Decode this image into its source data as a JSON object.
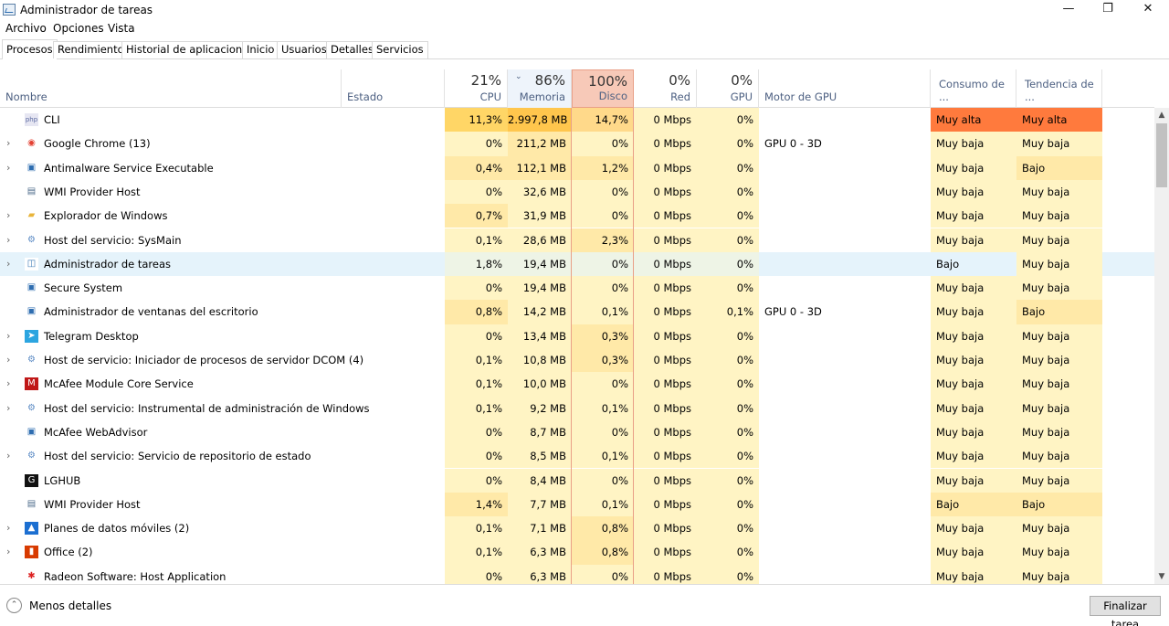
{
  "window": {
    "title": "Administrador de tareas",
    "minimize": "—",
    "maximize": "❐",
    "close": "✕"
  },
  "menu": [
    "Archivo",
    "Opciones",
    "Vista"
  ],
  "tabs": [
    "Procesos",
    "Rendimiento",
    "Historial de aplicaciones",
    "Inicio",
    "Usuarios",
    "Detalles",
    "Servicios"
  ],
  "header": {
    "name": "Nombre",
    "status": "Estado",
    "cpu_pct": "21%",
    "cpu": "CPU",
    "mem_pct": "86%",
    "mem": "Memoria",
    "disk_pct": "100%",
    "disk": "Disco",
    "net_pct": "0%",
    "net": "Red",
    "gpu_pct": "0%",
    "gpu": "GPU",
    "gpu_engine": "Motor de GPU",
    "power": "Consumo de ...",
    "trend": "Tendencia de ..."
  },
  "processes": [
    {
      "name": "CLI",
      "icon": "php-icon",
      "expand": false,
      "cpu": "11,3%",
      "mem": "2.997,8 MB",
      "disk": "14,7%",
      "net": "0 Mbps",
      "gpu": "0%",
      "engine": "",
      "power": "Muy alta",
      "trend": "Muy alta"
    },
    {
      "name": "Google Chrome (13)",
      "icon": "chrome-icon",
      "expand": true,
      "cpu": "0%",
      "mem": "211,2 MB",
      "disk": "0%",
      "net": "0 Mbps",
      "gpu": "0%",
      "engine": "GPU 0 - 3D",
      "power": "Muy baja",
      "trend": "Muy baja"
    },
    {
      "name": "Antimalware Service Executable",
      "icon": "service-window-icon",
      "expand": true,
      "cpu": "0,4%",
      "mem": "112,1 MB",
      "disk": "1,2%",
      "net": "0 Mbps",
      "gpu": "0%",
      "engine": "",
      "power": "Muy baja",
      "trend": "Bajo"
    },
    {
      "name": "WMI Provider Host",
      "icon": "wmi-icon",
      "expand": false,
      "cpu": "0%",
      "mem": "32,6 MB",
      "disk": "0%",
      "net": "0 Mbps",
      "gpu": "0%",
      "engine": "",
      "power": "Muy baja",
      "trend": "Muy baja"
    },
    {
      "name": "Explorador de Windows",
      "icon": "folder-icon",
      "expand": true,
      "cpu": "0,7%",
      "mem": "31,9 MB",
      "disk": "0%",
      "net": "0 Mbps",
      "gpu": "0%",
      "engine": "",
      "power": "Muy baja",
      "trend": "Muy baja"
    },
    {
      "name": "Host del servicio: SysMain",
      "icon": "gear-icon",
      "expand": true,
      "cpu": "0,1%",
      "mem": "28,6 MB",
      "disk": "2,3%",
      "net": "0 Mbps",
      "gpu": "0%",
      "engine": "",
      "power": "Muy baja",
      "trend": "Muy baja"
    },
    {
      "name": "Administrador de tareas",
      "icon": "taskmgr-icon",
      "expand": true,
      "cpu": "1,8%",
      "mem": "19,4 MB",
      "disk": "0%",
      "net": "0 Mbps",
      "gpu": "0%",
      "engine": "",
      "power": "Bajo",
      "trend": "Muy baja",
      "selected": true
    },
    {
      "name": "Secure System",
      "icon": "service-window-icon",
      "expand": false,
      "cpu": "0%",
      "mem": "19,4 MB",
      "disk": "0%",
      "net": "0 Mbps",
      "gpu": "0%",
      "engine": "",
      "power": "Muy baja",
      "trend": "Muy baja"
    },
    {
      "name": "Administrador de ventanas del escritorio",
      "icon": "service-window-icon",
      "expand": false,
      "cpu": "0,8%",
      "mem": "14,2 MB",
      "disk": "0,1%",
      "net": "0 Mbps",
      "gpu": "0,1%",
      "engine": "GPU 0 - 3D",
      "power": "Muy baja",
      "trend": "Bajo"
    },
    {
      "name": "Telegram Desktop",
      "icon": "telegram-icon",
      "expand": true,
      "cpu": "0%",
      "mem": "13,4 MB",
      "disk": "0,3%",
      "net": "0 Mbps",
      "gpu": "0%",
      "engine": "",
      "power": "Muy baja",
      "trend": "Muy baja"
    },
    {
      "name": "Host de servicio: Iniciador de procesos de servidor DCOM (4)",
      "icon": "gear-icon",
      "expand": true,
      "cpu": "0,1%",
      "mem": "10,8 MB",
      "disk": "0,3%",
      "net": "0 Mbps",
      "gpu": "0%",
      "engine": "",
      "power": "Muy baja",
      "trend": "Muy baja"
    },
    {
      "name": "McAfee Module Core Service",
      "icon": "mcafee-icon",
      "expand": true,
      "cpu": "0,1%",
      "mem": "10,0 MB",
      "disk": "0%",
      "net": "0 Mbps",
      "gpu": "0%",
      "engine": "",
      "power": "Muy baja",
      "trend": "Muy baja"
    },
    {
      "name": "Host del servicio: Instrumental de administración de Windows",
      "icon": "gear-icon",
      "expand": true,
      "cpu": "0,1%",
      "mem": "9,2 MB",
      "disk": "0,1%",
      "net": "0 Mbps",
      "gpu": "0%",
      "engine": "",
      "power": "Muy baja",
      "trend": "Muy baja"
    },
    {
      "name": "McAfee WebAdvisor",
      "icon": "service-window-icon",
      "expand": false,
      "cpu": "0%",
      "mem": "8,7 MB",
      "disk": "0%",
      "net": "0 Mbps",
      "gpu": "0%",
      "engine": "",
      "power": "Muy baja",
      "trend": "Muy baja"
    },
    {
      "name": "Host del servicio: Servicio de repositorio de estado",
      "icon": "gear-icon",
      "expand": true,
      "cpu": "0%",
      "mem": "8,5 MB",
      "disk": "0,1%",
      "net": "0 Mbps",
      "gpu": "0%",
      "engine": "",
      "power": "Muy baja",
      "trend": "Muy baja"
    },
    {
      "name": "LGHUB",
      "icon": "lghub-icon",
      "expand": false,
      "cpu": "0%",
      "mem": "8,4 MB",
      "disk": "0%",
      "net": "0 Mbps",
      "gpu": "0%",
      "engine": "",
      "power": "Muy baja",
      "trend": "Muy baja"
    },
    {
      "name": "WMI Provider Host",
      "icon": "wmi-icon",
      "expand": false,
      "cpu": "1,4%",
      "mem": "7,7 MB",
      "disk": "0,1%",
      "net": "0 Mbps",
      "gpu": "0%",
      "engine": "",
      "power": "Bajo",
      "trend": "Bajo"
    },
    {
      "name": "Planes de datos móviles (2)",
      "icon": "mobile-plans-icon",
      "expand": true,
      "cpu": "0,1%",
      "mem": "7,1 MB",
      "disk": "0,8%",
      "net": "0 Mbps",
      "gpu": "0%",
      "engine": "",
      "power": "Muy baja",
      "trend": "Muy baja"
    },
    {
      "name": "Office (2)",
      "icon": "office-icon",
      "expand": true,
      "cpu": "0,1%",
      "mem": "6,3 MB",
      "disk": "0,8%",
      "net": "0 Mbps",
      "gpu": "0%",
      "engine": "",
      "power": "Muy baja",
      "trend": "Muy baja"
    },
    {
      "name": "Radeon Software: Host Application",
      "icon": "radeon-icon",
      "expand": false,
      "cpu": "0%",
      "mem": "6,3 MB",
      "disk": "0%",
      "net": "0 Mbps",
      "gpu": "0%",
      "engine": "",
      "power": "Muy baja",
      "trend": "Muy baja"
    }
  ],
  "footer": {
    "less_details": "Menos detalles",
    "end_task": "Finalizar tarea"
  },
  "colors": {
    "heat_light": "#fff4c4",
    "heat_medium": "#ffe9a8",
    "heat_high": "#ffc64d",
    "heat_very_high": "#ff7a3d",
    "selected_row": "#e5f3fb"
  }
}
